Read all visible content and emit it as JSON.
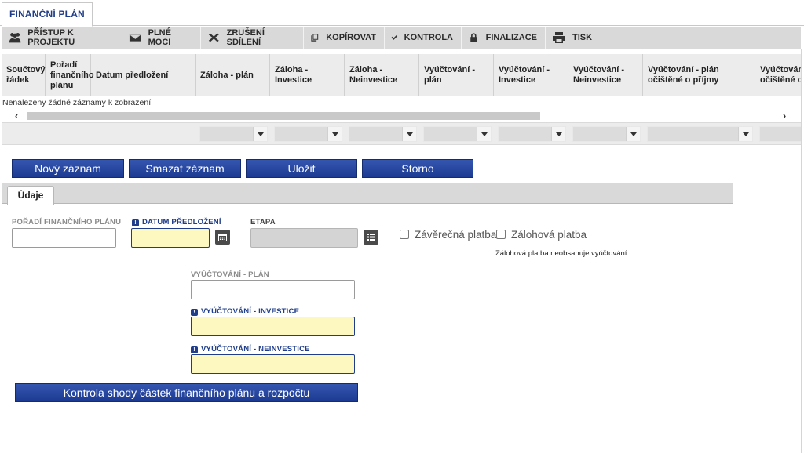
{
  "top_tab": {
    "label": "FINANČNÍ PLÁN"
  },
  "toolbar": [
    {
      "label": "PŘÍSTUP K PROJEKTU",
      "icon": "users-icon"
    },
    {
      "label": "PLNÉ MOCI",
      "icon": "envelope-icon"
    },
    {
      "label": "ZRUŠENÍ SDÍLENÍ",
      "icon": "cross-icon"
    },
    {
      "label": "KOPÍROVAT",
      "icon": "copy-icon"
    },
    {
      "label": "KONTROLA",
      "icon": "check-icon"
    },
    {
      "label": "FINALIZACE",
      "icon": "lock-icon"
    },
    {
      "label": "TISK",
      "icon": "printer-icon"
    }
  ],
  "grid": {
    "columns": [
      "Součtový řádek",
      "Pořadí finančního plánu",
      "Datum předložení",
      "Záloha - plán",
      "Záloha - Investice",
      "Záloha - Neinvestice",
      "Vyúčtování - plán",
      "Vyúčtování - Investice",
      "Vyúčtování - Neinvestice",
      "Vyúčtování - plán očištěné o příjmy",
      "Vyúčtování - plán očištěné o příjmy"
    ],
    "empty_message": "Nenalezeny žádné záznamy k zobrazení"
  },
  "actions": {
    "new": "Nový záznam",
    "delete": "Smazat záznam",
    "save": "Uložit",
    "cancel": "Storno"
  },
  "panel": {
    "tab": "Údaje",
    "fields": {
      "poradi_label": "POŘADÍ FINANČNÍHO PLÁNU",
      "datum_label": "DATUM PŘEDLOŽENÍ",
      "etapa_label": "ETAPA",
      "zaverecna_label": "Závěrečná platba",
      "zalohova_label": "Zálohová platba",
      "zalohova_note": "Zálohová platba neobsahuje vyúčtování",
      "vyuct_plan_label": "VYÚČTOVÁNÍ - PLÁN",
      "vyuct_inv_label": "VYÚČTOVÁNÍ - INVESTICE",
      "vyuct_neinv_label": "VYÚČTOVÁNÍ - NEINVESTICE"
    },
    "check_button": "Kontrola shody částek finančního plánu a rozpočtu"
  },
  "colors": {
    "accent": "#1f3d8a",
    "required_bg": "#fdf8c0",
    "button": "#2848a3"
  }
}
